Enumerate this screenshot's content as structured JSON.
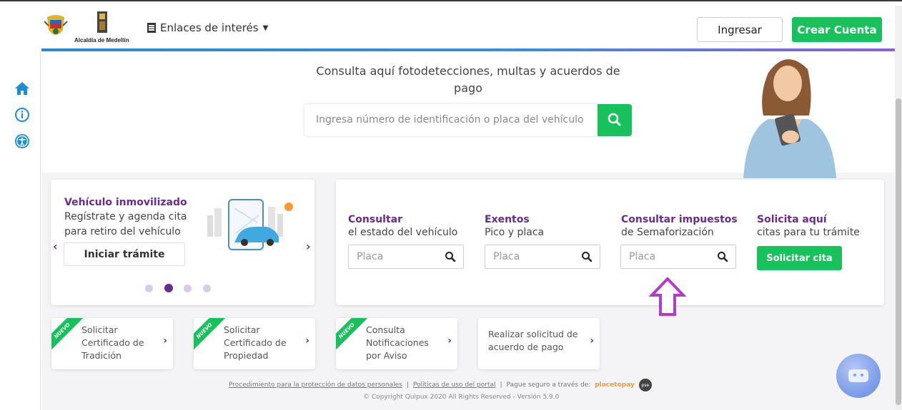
{
  "header": {
    "logo_text": "Alcaldía de Medellín",
    "enlaces_label": "Enlaces de interés",
    "ingresar_label": "Ingresar",
    "crear_cuenta_label": "Crear Cuenta"
  },
  "hero": {
    "title": "Consulta aquí fotodetecciones, multas y acuerdos de pago",
    "search_placeholder": "Ingresa número de identificación o placa del vehículo"
  },
  "carousel": {
    "title": "Vehículo inmovilizado",
    "text": "Regístrate y agenda cita para retiro del vehículo",
    "button": "Iniciar trámite",
    "prev": "‹",
    "next": "›",
    "active_slide": 2,
    "slides": 4
  },
  "services": [
    {
      "title": "Consultar",
      "subtitle": "el estado del vehículo",
      "placeholder": "Placa"
    },
    {
      "title": "Exentos",
      "subtitle": "Pico y placa",
      "placeholder": "Placa"
    },
    {
      "title": "Consultar impuestos",
      "subtitle": "de Semaforización",
      "placeholder": "Placa"
    },
    {
      "title": "Solicita aquí",
      "subtitle": "citas para tu trámite",
      "button": "Solicitar cita"
    }
  ],
  "quick_links": [
    {
      "badge": "NUEVO",
      "text": "Solicitar Certificado de Tradición"
    },
    {
      "badge": "NUEVO",
      "text": "Solicitar Certificado de Propiedad"
    },
    {
      "badge": "NUEVO",
      "text": "Consulta Notificaciones por Aviso"
    },
    {
      "badge": "",
      "text": "Realizar solicitud de acuerdo de pago"
    }
  ],
  "footer": {
    "link1": "Procedimiento para la protección de datos personales",
    "sep": "|",
    "link2": "Políticas de uso del portal",
    "pay_text": "Pague seguro a través de:",
    "placetopay": "placetopay",
    "pse": "pse",
    "copyright": "© Copyright Quipux 2020 All Rights Reserved - Versión 5.9.0"
  },
  "colors": {
    "primary_purple": "#6a2b91",
    "green": "#19c15c",
    "blue_bar": "#2e86d0",
    "icon_blue": "#1a8fd6"
  }
}
